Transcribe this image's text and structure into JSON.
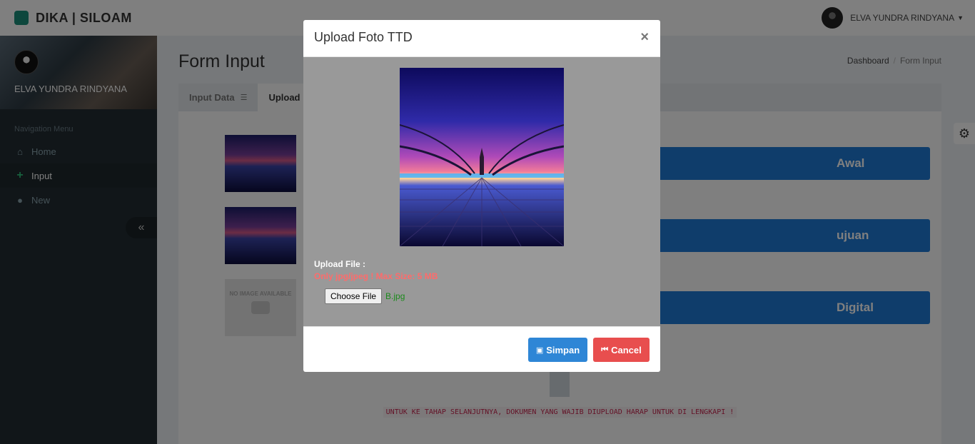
{
  "app": {
    "brand": "DIKA | SILOAM",
    "user_name": "ELVA YUNDRA RINDYANA"
  },
  "sidebar": {
    "user_name": "ELVA YUNDRA RINDYANA",
    "nav_header": "Navigation Menu",
    "items": [
      {
        "label": "Home",
        "icon": "home-icon"
      },
      {
        "label": "Input",
        "icon": "plus-icon"
      },
      {
        "label": "New",
        "icon": "user-icon"
      }
    ]
  },
  "page": {
    "title": "Form Input",
    "breadcrumb": [
      "Dashboard",
      "Form Input"
    ],
    "tabs": [
      {
        "label": "Input Data",
        "icon": "database-icon"
      },
      {
        "label": "Upload"
      }
    ],
    "no_image_text": "NO IMAGE AVAILABLE",
    "action_buttons": [
      "Awal",
      "ujuan",
      "Digital"
    ],
    "note": "UNTUK KE TAHAP SELANJUTNYA, DOKUMEN YANG WAJIB DIUPLOAD HARAP UNTUK DI LENGKAPI !"
  },
  "modal": {
    "title": "Upload Foto TTD",
    "close_label": "×",
    "upload_label": "Upload File :",
    "upload_hint": "Only jpg/jpeg ! Max Size: 5 MB",
    "choose_file_label": "Choose File",
    "file_name": "B.jpg",
    "save_label": "Simpan",
    "cancel_label": "Cancel"
  },
  "colors": {
    "primary": "#2e86d6",
    "danger": "#e84e4e",
    "sidebar": "#222d32"
  }
}
